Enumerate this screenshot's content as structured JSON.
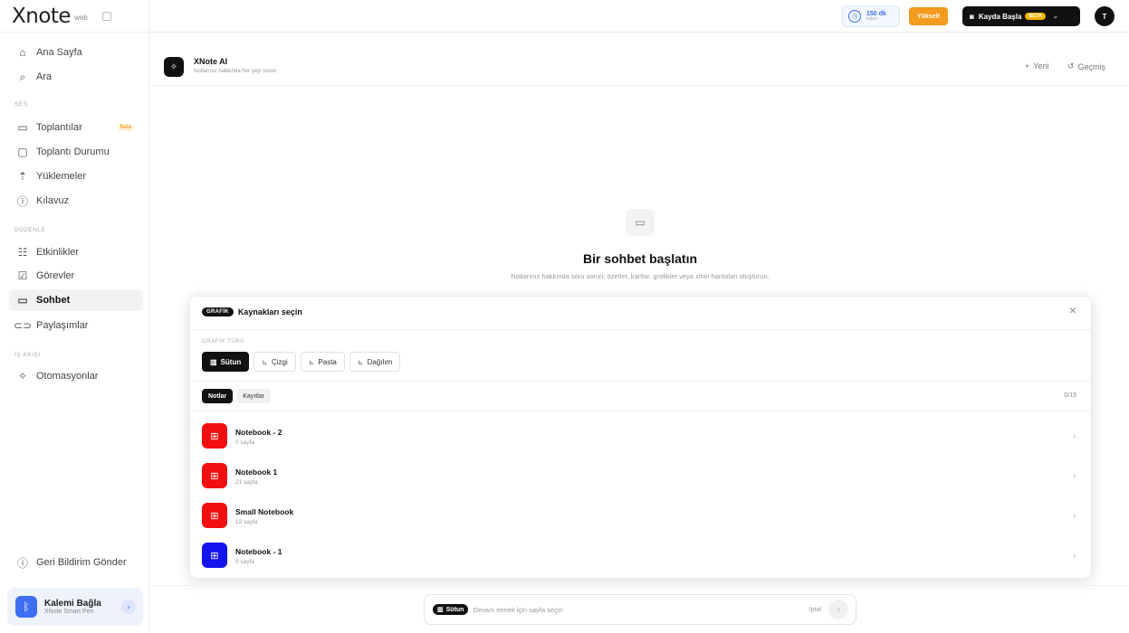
{
  "app": {
    "logo": "Xnote",
    "logo_sub": "web"
  },
  "sidebar": {
    "items_top": [
      {
        "label": "Ana Sayfa",
        "icon": "home-icon"
      },
      {
        "label": "Ara",
        "icon": "search-icon"
      }
    ],
    "section_ses": "SES",
    "items_ses": [
      {
        "label": "Toplantılar",
        "icon": "calendar-icon",
        "badge": "Beta"
      },
      {
        "label": "Toplantı Durumu",
        "icon": "clipboard-icon"
      },
      {
        "label": "Yüklemeler",
        "icon": "upload-icon"
      },
      {
        "label": "Kılavuz",
        "icon": "help-icon"
      }
    ],
    "section_duzenle": "DÜZENLE",
    "items_duzenle": [
      {
        "label": "Etkinlikler",
        "icon": "grid-icon"
      },
      {
        "label": "Görevler",
        "icon": "checkbox-icon"
      },
      {
        "label": "Sohbet",
        "icon": "chat-icon"
      },
      {
        "label": "Paylaşımlar",
        "icon": "link-icon"
      }
    ],
    "section_is_akisi": "İŞ AKIŞI",
    "items_is_akisi": [
      {
        "label": "Otomasyonlar",
        "icon": "sparkle-icon"
      }
    ],
    "feedback": "Geri Bildirim Gönder",
    "pen": {
      "title": "Kalemi Bağla",
      "subtitle": "XNote Smart Pen"
    }
  },
  "topbar": {
    "credit_value": "150 dk",
    "credit_label": "kalan",
    "upgrade": "Yükselt",
    "record": "Kayda Başla",
    "record_badge": "BETA",
    "avatar": "T"
  },
  "chat": {
    "title": "XNote AI",
    "subtitle": "Notlarınız hakkında her şeyi sorun",
    "new_label": "Yeni",
    "history_label": "Geçmiş",
    "empty_title": "Bir sohbet başlatın",
    "empty_desc": "Notlarınız hakkında soru sorun; özetler, kartlar, grafikler veya zihin haritaları oluşturun."
  },
  "modal": {
    "tag": "GRAFİK",
    "title": "Kaynakları seçin",
    "type_label": "GRAFİK TÜRÜ",
    "types": [
      "Sütun",
      "Çizgi",
      "Pasta",
      "Dağılım"
    ],
    "tabs": [
      "Notlar",
      "Kayıtlar"
    ],
    "count": "0/15",
    "notebooks": [
      {
        "name": "Notebook - 2",
        "pages": "0 sayfa",
        "color": "#f20f0f"
      },
      {
        "name": "Notebook 1",
        "pages": "21 sayfa",
        "color": "#f20f0f"
      },
      {
        "name": "Small Notebook",
        "pages": "12 sayfa",
        "color": "#f20f0f"
      },
      {
        "name": "Notebook - 1",
        "pages": "0 sayfa",
        "color": "#1414ee"
      }
    ]
  },
  "composer": {
    "chip": "Sütun",
    "placeholder": "Devam etmek için sayfa seçin",
    "cancel": "İptal"
  }
}
